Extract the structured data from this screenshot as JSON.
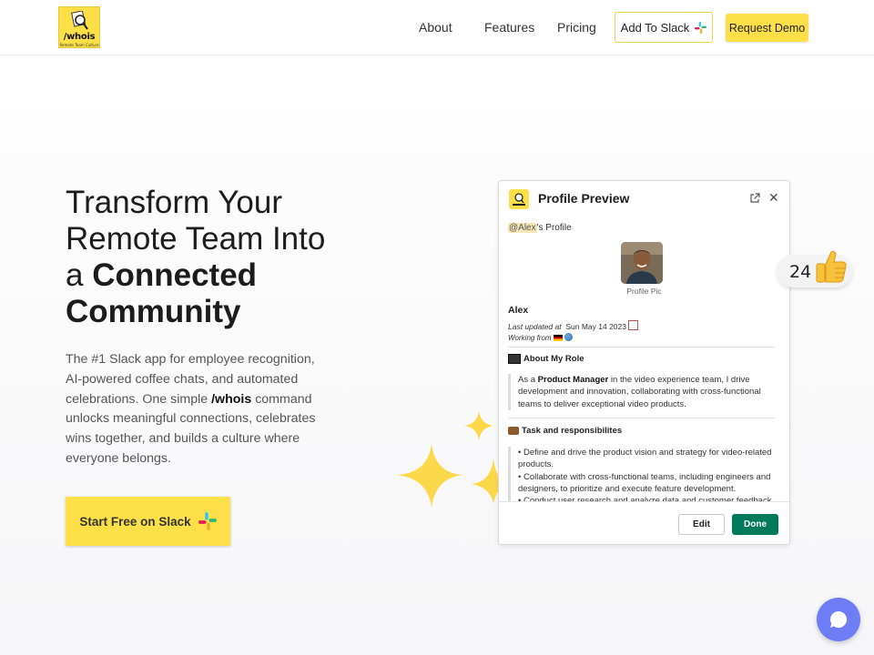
{
  "header": {
    "logo": {
      "wordmark": "/whois",
      "tagline": "Remote Team Culture"
    },
    "nav": [
      {
        "label": "About"
      },
      {
        "label": "Features"
      },
      {
        "label": "Pricing"
      }
    ],
    "add_to_slack": "Add To Slack",
    "request_demo": "Request Demo"
  },
  "hero": {
    "title_line1": "Transform Your",
    "title_line2": "Remote Team Into",
    "title_a": "a ",
    "title_bold1": "Connected",
    "title_bold2": "Community",
    "desc_part1": "The #1 Slack app for employee recognition, AI-powered coffee chats, and automated celebrations. One simple ",
    "desc_command": "/whois",
    "desc_part2": " command unlocks meaningful connections, celebrates wins together, and builds a culture where everyone belongs.",
    "cta": "Start Free on Slack"
  },
  "card": {
    "title": "Profile Preview",
    "mention": "@Alex",
    "profile_suffix": "'s Profile",
    "avatar_caption": "Profile Pic",
    "name": "Alex",
    "updated_label": "Last updated at",
    "updated_value": "Sun May 14 2023",
    "working_label": "Working from",
    "about_heading": "About My Role",
    "about_pre": "As a ",
    "about_role": "Product Manager",
    "about_post": " in the video experience team, I drive development and innovation, collaborating with cross-functional teams to deliver exceptional video products.",
    "task_heading": "Task and responsibilites",
    "tasks": [
      "• Define and drive the product vision and strategy for video-related products.",
      "• Collaborate with cross-functional teams, including engineers and designers, to prioritize and execute feature development.",
      "• Conduct user research and analyze data and customer feedback to"
    ],
    "edit": "Edit",
    "done": "Done"
  },
  "like_badge": {
    "count": "24"
  },
  "colors": {
    "brand_yellow": "#fde047",
    "done_green": "#007a5a",
    "chat_blue": "#6c7df5"
  }
}
